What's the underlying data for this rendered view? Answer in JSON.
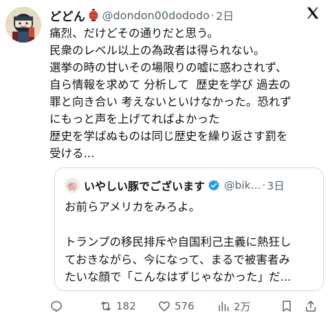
{
  "tweet": {
    "author_name": "どどん",
    "handle": "@dondon00dododo",
    "dot": "·",
    "time": "2日",
    "text": "痛烈、だけどその通りだと思う。\n民衆のレベル以上の為政者は得られない。\n選挙の時の甘いその場限りの嘘に惑わされず、\n自ら情報を求めて 分析して  歴史を学び 過去の\n罪と向き合い 考えないといけなかった。恐れず\nにもっと声を上げてればよかった\n歴史を学ばぬものは同じ歴史を繰り返さす罰を\n受ける..."
  },
  "quote": {
    "author_name": "いやしい豚でございます",
    "handle": "@bik...",
    "dot": "·",
    "time": "3日",
    "text": "お前らアメリカをみろよ。\n\nトランプの移民排斥や自国利己主義に熱狂し\nておきながら、今になって、まるで被害者み\nたいな顔で「こんなはずじゃなかった」だ..."
  },
  "actions": {
    "reply_count": "",
    "retweet_count": "182",
    "like_count": "576",
    "views_count": "2万",
    "reply_icon": "reply-icon",
    "retweet_icon": "retweet-icon",
    "like_icon": "heart-icon",
    "views_icon": "views-icon",
    "bookmark_icon": "bookmark-icon",
    "share_icon": "share-icon"
  },
  "colors": {
    "text": "#0f1419",
    "secondary": "#536471",
    "border": "#cfd9de",
    "verified": "#1d9bf0",
    "lantern": "#d9483b"
  }
}
